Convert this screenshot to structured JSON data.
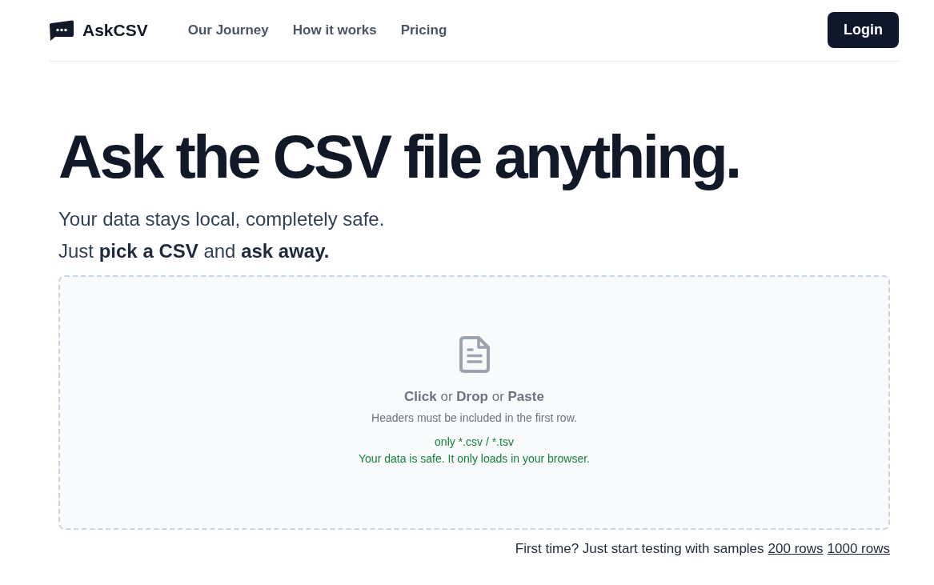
{
  "header": {
    "logo": {
      "text": "AskCSV"
    },
    "nav": [
      {
        "label": "Our Journey"
      },
      {
        "label": "How it works"
      },
      {
        "label": "Pricing"
      }
    ],
    "login_button": "Login"
  },
  "hero": {
    "title": "Ask the CSV file anything.",
    "subtitle_lines": [
      "Your data stays local, completely safe.",
      "Just **pick a CSV** and **ask away.**"
    ]
  },
  "dropzone": {
    "prompt": "**Click** or **Drop** or **Paste**",
    "hint": "Headers must be included in the first row.",
    "notes": [
      "only *.csv / *.tsv",
      "Your data is safe. It only loads in your browser."
    ]
  },
  "samples": {
    "text": "First time? Just start testing with samples",
    "links": [
      "200 rows",
      "1000 rows"
    ]
  }
}
